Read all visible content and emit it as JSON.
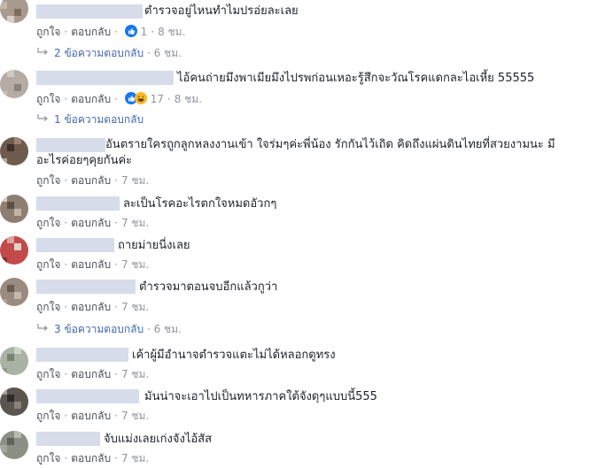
{
  "comments": [
    {
      "text": "ตำรวจอยู่ไหนทำไมปรอ่ยละเลย",
      "like": "ถูกใจ",
      "reply": "ตอบกลับ",
      "reactions": "1",
      "time": "8 ชม.",
      "replies": {
        "label": "2 ข้อความตอบกลับ",
        "time": "6 ชม."
      }
    },
    {
      "text": "ไอ้คนถ่ายมึงพาเมียมึงไปรพก่อนเหอะรู้สึกจะวัณโรคแดกละไอเหี้ย 55555",
      "like": "ถูกใจ",
      "reply": "ตอบกลับ",
      "reactions": "17",
      "time": "8 ชม.",
      "replies": {
        "label": "1 ข้อความตอบกลับ",
        "time": ""
      }
    },
    {
      "text": "อันตรายใครถูกลูกหลงงานเข้า ใจร่มๆค่ะพี่น้อง รักกันไว้เถิด คิดถึงแผ่นดินไทยที่สวยงามนะ มีอะไรค่อยๆคุยกันค่ะ",
      "like": "ถูกใจ",
      "reply": "ตอบกลับ",
      "reactions": "",
      "time": "7 ชม."
    },
    {
      "text": "ละเป็นโรคอะไรตกใจหมดอัวกๆ",
      "like": "ถูกใจ",
      "reply": "ตอบกลับ",
      "reactions": "",
      "time": "7 ชม."
    },
    {
      "text": "ถายม่ายนี่งเลย",
      "like": "ถูกใจ",
      "reply": "ตอบกลับ",
      "reactions": "",
      "time": "7 ชม."
    },
    {
      "text": "ตำรวจมาตอนจบอีกแล้วกูว่า",
      "like": "ถูกใจ",
      "reply": "ตอบกลับ",
      "reactions": "",
      "time": "7 ชม.",
      "replies": {
        "label": "3 ข้อความตอบกลับ",
        "time": "6 ชม."
      }
    },
    {
      "text": "เค้าผู้มีอำนาจตำรวจแตะไม่ได้หลอกดูทรง",
      "like": "ถูกใจ",
      "reply": "ตอบกลับ",
      "reactions": "",
      "time": "7 ชม."
    },
    {
      "text": "มันน่าจะเอาไปเป็นทหารภาคใต้จังดุๆแบบนี้555",
      "like": "ถูกใจ",
      "reply": "ตอบกลับ",
      "reactions": "",
      "time": "7 ชม."
    },
    {
      "text": "จับแม่งเลยเก่งจังไอ้สัส",
      "like": "ถูกใจ",
      "reply": "ตอบกลับ",
      "reactions": "",
      "time": "7 ชม."
    }
  ],
  "icons": {
    "like": "like-reaction-icon",
    "haha": "haha-reaction-icon",
    "reply_arrow": "reply-arrow-icon"
  },
  "colors": {
    "link": "#4b4f56",
    "meta": "#90949c",
    "reply": "#4267b2",
    "like_blue": "#1877f2"
  }
}
